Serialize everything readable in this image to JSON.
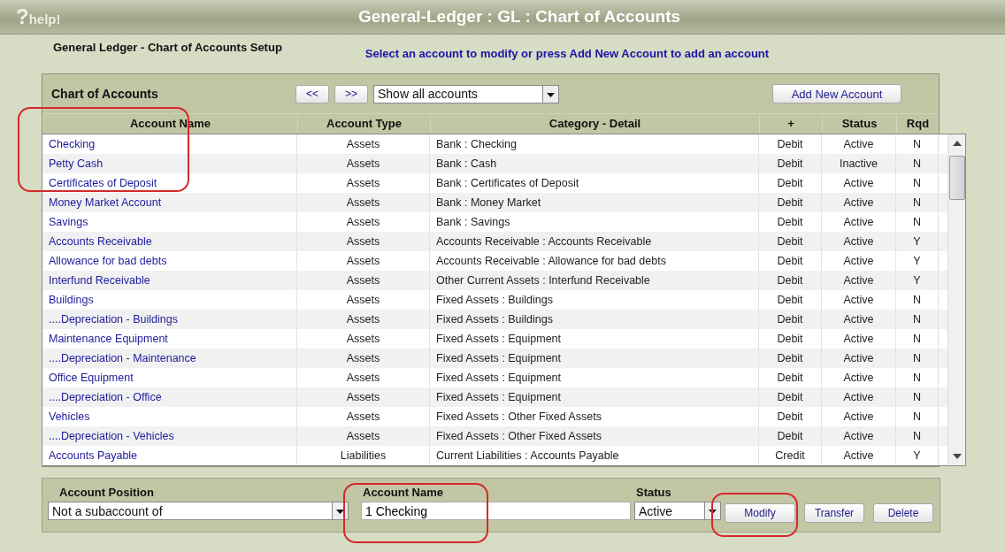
{
  "header": {
    "logo_mark": "?",
    "logo_text": "help!",
    "title": "General-Ledger : GL : Chart of Accounts"
  },
  "page": {
    "heading": "General Ledger - Chart of Accounts Setup",
    "instruction": "Select an account to modify or press Add New Account to add an account"
  },
  "toolbar": {
    "title": "Chart of Accounts",
    "prev_button": "<<",
    "next_button": ">>",
    "filter": {
      "value": "Show all accounts"
    },
    "add_button": "Add New Account"
  },
  "table": {
    "columns": [
      "Account Name",
      "Account Type",
      "Category - Detail",
      "+",
      "Status",
      "Rqd"
    ],
    "rows": [
      {
        "name": "Checking",
        "type": "Assets",
        "category": "Bank : Checking",
        "side": "Debit",
        "status": "Active",
        "rqd": "N"
      },
      {
        "name": "Petty Cash",
        "type": "Assets",
        "category": "Bank : Cash",
        "side": "Debit",
        "status": "Inactive",
        "rqd": "N"
      },
      {
        "name": "Certificates of Deposit",
        "type": "Assets",
        "category": "Bank : Certificates of Deposit",
        "side": "Debit",
        "status": "Active",
        "rqd": "N"
      },
      {
        "name": "Money Market Account",
        "type": "Assets",
        "category": "Bank : Money Market",
        "side": "Debit",
        "status": "Active",
        "rqd": "N"
      },
      {
        "name": "Savings",
        "type": "Assets",
        "category": "Bank : Savings",
        "side": "Debit",
        "status": "Active",
        "rqd": "N"
      },
      {
        "name": "Accounts Receivable",
        "type": "Assets",
        "category": "Accounts Receivable : Accounts Receivable",
        "side": "Debit",
        "status": "Active",
        "rqd": "Y"
      },
      {
        "name": "Allowance for bad debts",
        "type": "Assets",
        "category": "Accounts Receivable : Allowance for bad debts",
        "side": "Debit",
        "status": "Active",
        "rqd": "Y"
      },
      {
        "name": "Interfund Receivable",
        "type": "Assets",
        "category": "Other Current Assets : Interfund Receivable",
        "side": "Debit",
        "status": "Active",
        "rqd": "Y"
      },
      {
        "name": "Buildings",
        "type": "Assets",
        "category": "Fixed Assets : Buildings",
        "side": "Debit",
        "status": "Active",
        "rqd": "N"
      },
      {
        "name": "....Depreciation - Buildings",
        "type": "Assets",
        "category": "Fixed Assets : Buildings",
        "side": "Debit",
        "status": "Active",
        "rqd": "N"
      },
      {
        "name": "Maintenance Equipment",
        "type": "Assets",
        "category": "Fixed Assets : Equipment",
        "side": "Debit",
        "status": "Active",
        "rqd": "N"
      },
      {
        "name": "....Depreciation - Maintenance",
        "type": "Assets",
        "category": "Fixed Assets : Equipment",
        "side": "Debit",
        "status": "Active",
        "rqd": "N"
      },
      {
        "name": "Office Equipment",
        "type": "Assets",
        "category": "Fixed Assets : Equipment",
        "side": "Debit",
        "status": "Active",
        "rqd": "N"
      },
      {
        "name": "....Depreciation - Office",
        "type": "Assets",
        "category": "Fixed Assets : Equipment",
        "side": "Debit",
        "status": "Active",
        "rqd": "N"
      },
      {
        "name": "Vehicles",
        "type": "Assets",
        "category": "Fixed Assets : Other Fixed Assets",
        "side": "Debit",
        "status": "Active",
        "rqd": "N"
      },
      {
        "name": "....Depreciation - Vehicles",
        "type": "Assets",
        "category": "Fixed Assets : Other Fixed Assets",
        "side": "Debit",
        "status": "Active",
        "rqd": "N"
      },
      {
        "name": "Accounts Payable",
        "type": "Liabilities",
        "category": "Current Liabilities : Accounts Payable",
        "side": "Credit",
        "status": "Active",
        "rqd": "Y"
      }
    ]
  },
  "editor": {
    "position_label": "Account Position",
    "position_value": "Not a subaccount of",
    "name_label": "Account Name",
    "name_value": "1 Checking",
    "status_label": "Status",
    "status_value": "Active",
    "buttons": [
      "Modify",
      "Transfer",
      "Delete"
    ]
  }
}
